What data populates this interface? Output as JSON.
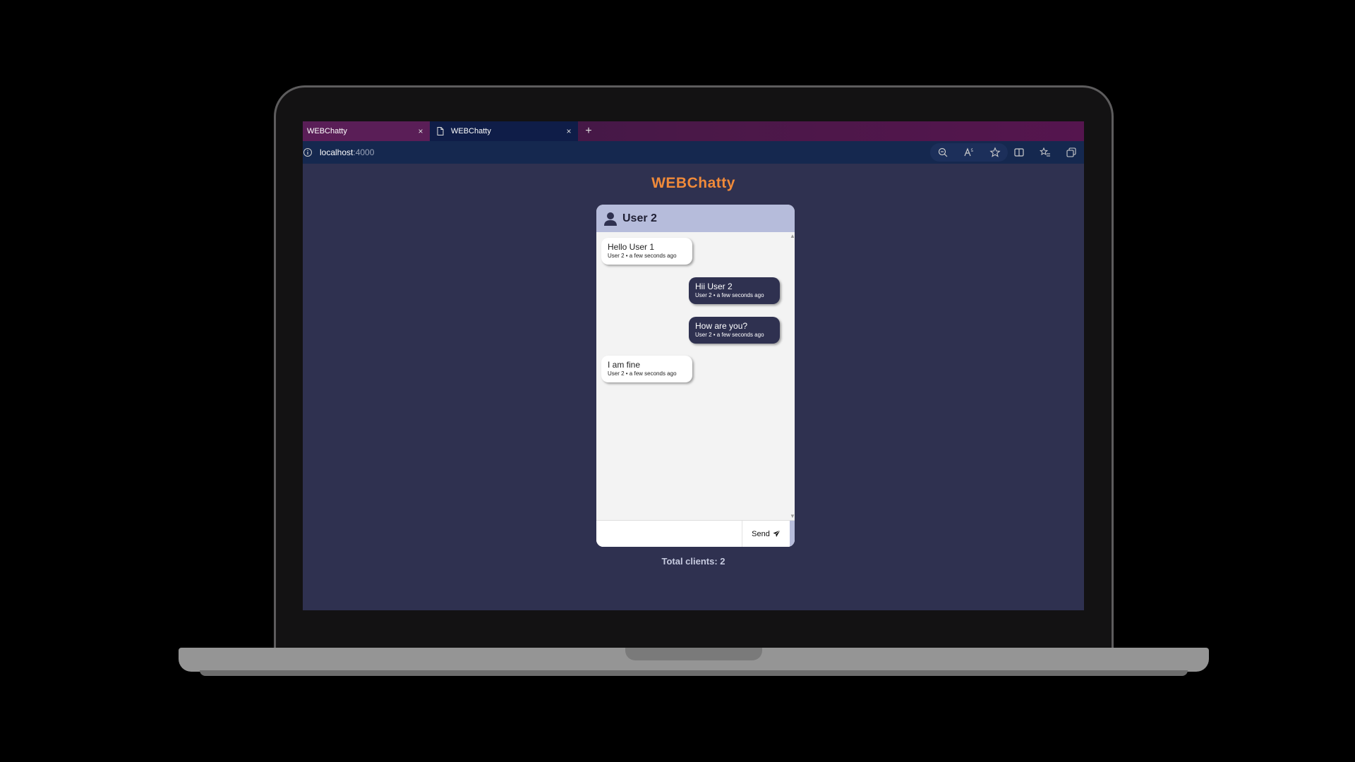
{
  "browser": {
    "tabs": [
      {
        "label": "WEBChatty",
        "close": "×"
      },
      {
        "label": "WEBChatty",
        "close": "×"
      }
    ],
    "new_tab": "+",
    "url_host": "localhost",
    "url_port": ":4000"
  },
  "page": {
    "brand": "WEBChatty",
    "chat_title": "User 2",
    "messages": [
      {
        "text": "Hello User 1",
        "meta": "User 2 • a few seconds ago",
        "direction": "incoming"
      },
      {
        "text": "Hii User 2",
        "meta": "User 2 • a few seconds ago",
        "direction": "outgoing"
      },
      {
        "text": "How are you?",
        "meta": "User 2 • a few seconds ago",
        "direction": "outgoing"
      },
      {
        "text": "I am fine",
        "meta": "User 2 • a few seconds ago",
        "direction": "incoming"
      }
    ],
    "input_value": "",
    "send_label": "Send",
    "clients_text": "Total clients: 2"
  },
  "colors": {
    "brand": "#f08a3a",
    "page_bg": "#2f3150",
    "header_bg": "#b6bcdb",
    "outgoing_bubble": "#2f3150",
    "incoming_bubble": "#ffffff"
  },
  "icons": [
    "document-icon",
    "info-icon",
    "zoom-out-icon",
    "read-aloud-icon",
    "star-icon",
    "split-screen-icon",
    "favorites-icon",
    "collections-icon",
    "user-icon",
    "send-icon"
  ]
}
